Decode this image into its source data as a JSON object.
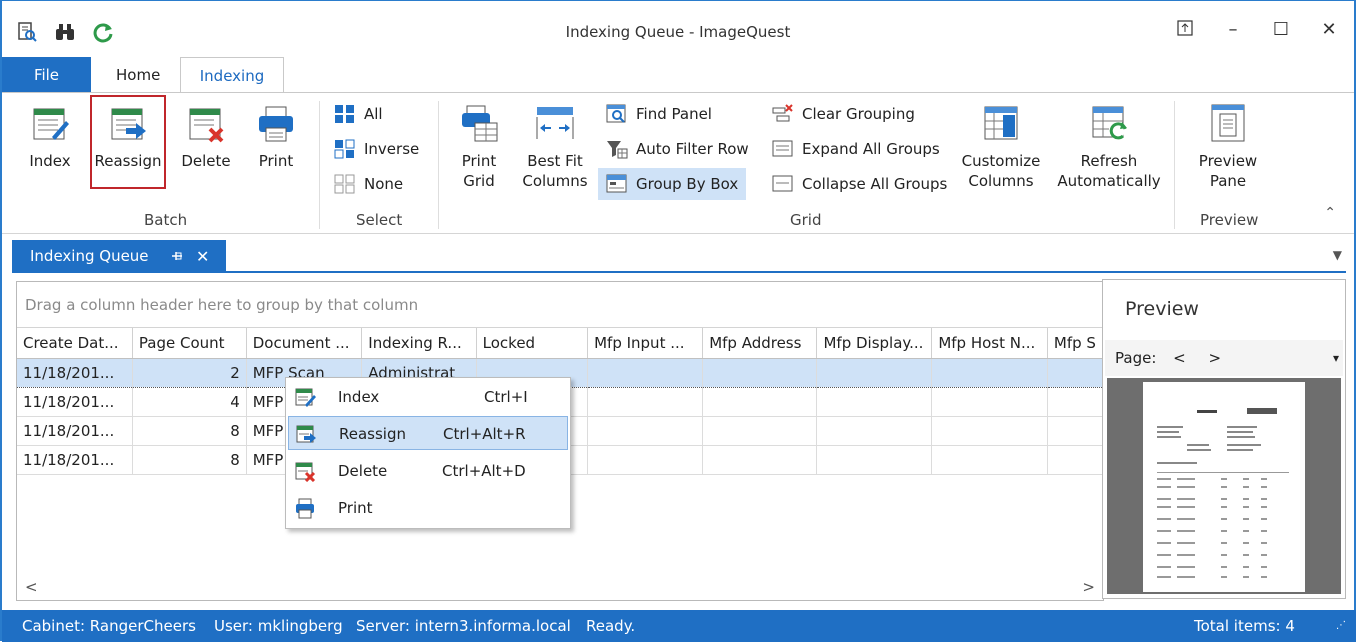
{
  "window": {
    "title": "Indexing Queue - ImageQuest",
    "controls": {
      "restore": "⊤",
      "minimize": "–",
      "maximize": "☐",
      "close": "✕"
    }
  },
  "quick_access": [
    "search-doc-icon",
    "binoculars-icon",
    "refresh-icon"
  ],
  "ribbon_tabs": {
    "file": "File",
    "home": "Home",
    "indexing": "Indexing"
  },
  "ribbon": {
    "batch": {
      "label": "Batch",
      "index": "Index",
      "reassign": "Reassign",
      "delete": "Delete",
      "print": "Print"
    },
    "select": {
      "label": "Select",
      "all": "All",
      "inverse": "Inverse",
      "none": "None"
    },
    "grid": {
      "label": "Grid",
      "print_grid_line1": "Print",
      "print_grid_line2": "Grid",
      "best_fit_line1": "Best Fit",
      "best_fit_line2": "Columns",
      "find_panel": "Find Panel",
      "auto_filter_row": "Auto Filter Row",
      "group_by_box": "Group By Box",
      "clear_grouping": "Clear Grouping",
      "expand_all_groups": "Expand All Groups",
      "collapse_all_groups": "Collapse All Groups",
      "customize_line1": "Customize",
      "customize_line2": "Columns",
      "refresh_line1": "Refresh",
      "refresh_line2": "Automatically"
    },
    "preview": {
      "label": "Preview",
      "pane_line1": "Preview",
      "pane_line2": "Pane"
    }
  },
  "doc_tab": {
    "label": "Indexing Queue",
    "pin": "⊕",
    "close": "✕"
  },
  "grid": {
    "group_hint": "Drag a column header here to group by that column",
    "columns": [
      "Create Dat...",
      "Page Count",
      "Document ...",
      "Indexing R...",
      "Locked",
      "Mfp Input ...",
      "Mfp Address",
      "Mfp Display...",
      "Mfp Host N...",
      "Mfp S"
    ],
    "rows": [
      [
        "11/18/201...",
        "2",
        "MFP Scan",
        "Administrat",
        "",
        "",
        "",
        "",
        "",
        ""
      ],
      [
        "11/18/201...",
        "4",
        "MFP",
        "",
        "",
        "",
        "",
        "",
        "",
        ""
      ],
      [
        "11/18/201...",
        "8",
        "MFP",
        "",
        "",
        "",
        "",
        "",
        "",
        ""
      ],
      [
        "11/18/201...",
        "8",
        "MFP",
        "",
        "",
        "",
        "",
        "",
        "",
        ""
      ]
    ],
    "scroll_left": "<",
    "scroll_right": ">"
  },
  "preview": {
    "title": "Preview",
    "page_label": "Page:",
    "prev": "<",
    "next": ">"
  },
  "context_menu": [
    {
      "label": "Index",
      "shortcut": "Ctrl+I",
      "icon": "index-icon"
    },
    {
      "label": "Reassign",
      "shortcut": "Ctrl+Alt+R",
      "icon": "reassign-icon"
    },
    {
      "label": "Delete",
      "shortcut": "Ctrl+Alt+D",
      "icon": "delete-icon"
    },
    {
      "label": "Print",
      "shortcut": "",
      "icon": "print-icon"
    }
  ],
  "status": {
    "cabinet": "Cabinet: RangerCheers",
    "user": "User: mklingberg",
    "server": "Server: intern3.informa.local",
    "state": "Ready.",
    "total": "Total items: 4"
  },
  "colors": {
    "accent": "#1f6fc4",
    "selection": "#cfe2f7",
    "delete_red": "#d9342b",
    "sheet_green": "#2f8a4a"
  }
}
